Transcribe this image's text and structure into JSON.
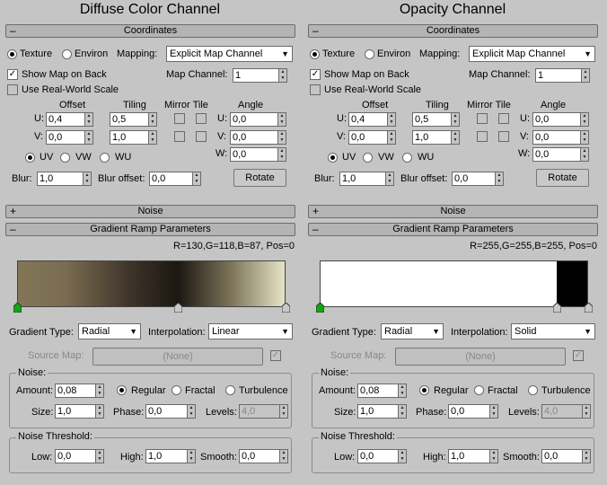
{
  "panels": [
    {
      "title": "Diffuse Color Channel",
      "coordinates": {
        "header": "Coordinates",
        "texture_label": "Texture",
        "environ_label": "Environ",
        "mapping_label": "Mapping:",
        "mapping_value": "Explicit Map Channel",
        "show_map_label": "Show Map on Back",
        "map_channel_label": "Map Channel:",
        "map_channel_value": "1",
        "real_world_label": "Use Real-World Scale",
        "offset_label": "Offset",
        "tiling_label": "Tiling",
        "mirror_tile_label": "Mirror Tile",
        "angle_label": "Angle",
        "u_label": "U:",
        "v_label": "V:",
        "w_label": "W:",
        "u_offset": "0,4",
        "v_offset": "0,0",
        "u_tiling": "0,5",
        "v_tiling": "1,0",
        "u_angle": "0,0",
        "v_angle": "0,0",
        "w_angle": "0,0",
        "uv_label": "UV",
        "vw_label": "VW",
        "wu_label": "WU",
        "blur_label": "Blur:",
        "blur_value": "1,0",
        "blur_offset_label": "Blur offset:",
        "blur_offset_value": "0,0",
        "rotate_label": "Rotate"
      },
      "noise_rollout": "Noise",
      "gradient": {
        "header": "Gradient Ramp Parameters",
        "readout": "R=130,G=118,B=87, Pos=0",
        "stops": [
          {
            "pos": 0,
            "color": "#827657"
          },
          {
            "pos": 0.18,
            "color": "#7a6c50"
          },
          {
            "pos": 0.42,
            "color": "#3e342a"
          },
          {
            "pos": 0.6,
            "color": "#1c1712"
          },
          {
            "pos": 0.8,
            "color": "#7d755a"
          },
          {
            "pos": 1,
            "color": "#e6e4c8"
          }
        ],
        "flags": [
          {
            "pos": 0,
            "color": "#11a611"
          },
          {
            "pos": 0.6,
            "color": "#c8c8c8"
          },
          {
            "pos": 1,
            "color": "#c8c8c8"
          }
        ],
        "gradient_type_label": "Gradient Type:",
        "gradient_type_value": "Radial",
        "interpolation_label": "Interpolation:",
        "interpolation_value": "Linear",
        "source_map_label": "Source Map:",
        "source_map_value": "(None)",
        "noise_group": "Noise:",
        "amount_label": "Amount:",
        "amount_value": "0,08",
        "regular_label": "Regular",
        "fractal_label": "Fractal",
        "turbulence_label": "Turbulence",
        "size_label": "Size:",
        "size_value": "1,0",
        "phase_label": "Phase:",
        "phase_value": "0,0",
        "levels_label": "Levels:",
        "levels_value": "4,0",
        "threshold_group": "Noise Threshold:",
        "low_label": "Low:",
        "low_value": "0,0",
        "high_label": "High:",
        "high_value": "1,0",
        "smooth_label": "Smooth:",
        "smooth_value": "0,0"
      }
    },
    {
      "title": "Opacity Channel",
      "coordinates": {
        "header": "Coordinates",
        "texture_label": "Texture",
        "environ_label": "Environ",
        "mapping_label": "Mapping:",
        "mapping_value": "Explicit Map Channel",
        "show_map_label": "Show Map on Back",
        "map_channel_label": "Map Channel:",
        "map_channel_value": "1",
        "real_world_label": "Use Real-World Scale",
        "offset_label": "Offset",
        "tiling_label": "Tiling",
        "mirror_tile_label": "Mirror Tile",
        "angle_label": "Angle",
        "u_label": "U:",
        "v_label": "V:",
        "w_label": "W:",
        "u_offset": "0,4",
        "v_offset": "0,0",
        "u_tiling": "0,5",
        "v_tiling": "1,0",
        "u_angle": "0,0",
        "v_angle": "0,0",
        "w_angle": "0,0",
        "uv_label": "UV",
        "vw_label": "VW",
        "wu_label": "WU",
        "blur_label": "Blur:",
        "blur_value": "1,0",
        "blur_offset_label": "Blur offset:",
        "blur_offset_value": "0,0",
        "rotate_label": "Rotate"
      },
      "noise_rollout": "Noise",
      "gradient": {
        "header": "Gradient Ramp Parameters",
        "readout": "R=255,G=255,B=255, Pos=0",
        "stops": [
          {
            "pos": 0,
            "color": "#ffffff"
          },
          {
            "pos": 0.885,
            "color": "#ffffff"
          },
          {
            "pos": 0.886,
            "color": "#000000"
          },
          {
            "pos": 1,
            "color": "#000000"
          }
        ],
        "flags": [
          {
            "pos": 0,
            "color": "#11a611"
          },
          {
            "pos": 0.885,
            "color": "#c8c8c8"
          },
          {
            "pos": 1,
            "color": "#c8c8c8"
          }
        ],
        "gradient_type_label": "Gradient Type:",
        "gradient_type_value": "Radial",
        "interpolation_label": "Interpolation:",
        "interpolation_value": "Solid",
        "source_map_label": "Source Map:",
        "source_map_value": "(None)",
        "noise_group": "Noise:",
        "amount_label": "Amount:",
        "amount_value": "0,08",
        "regular_label": "Regular",
        "fractal_label": "Fractal",
        "turbulence_label": "Turbulence",
        "size_label": "Size:",
        "size_value": "1,0",
        "phase_label": "Phase:",
        "phase_value": "0,0",
        "levels_label": "Levels:",
        "levels_value": "4,0",
        "threshold_group": "Noise Threshold:",
        "low_label": "Low:",
        "low_value": "0,0",
        "high_label": "High:",
        "high_value": "1,0",
        "smooth_label": "Smooth:",
        "smooth_value": "0,0"
      }
    }
  ],
  "rollout_collapsed_symbol": "+",
  "rollout_expanded_symbol": "–"
}
